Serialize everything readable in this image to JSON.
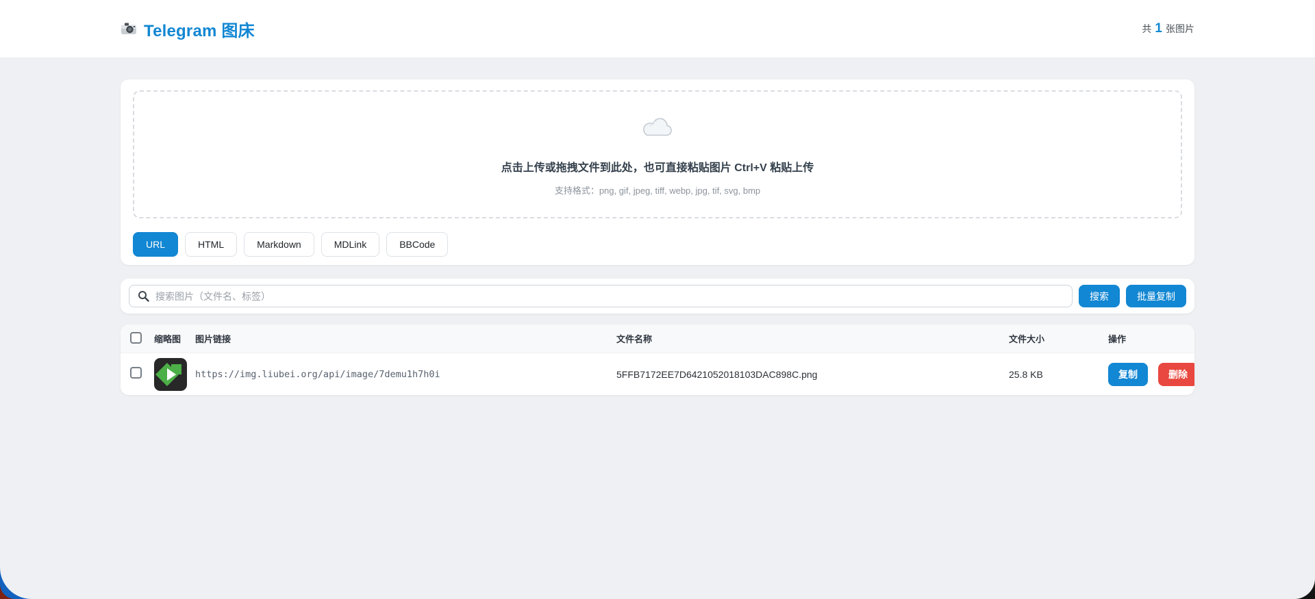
{
  "header": {
    "logo_icon": "camera",
    "title": "Telegram 图床",
    "count_prefix": "共",
    "count_value": "1",
    "count_suffix": "张图片"
  },
  "upload": {
    "cloud_icon": "cloud",
    "main_text": "点击上传或拖拽文件到此处，也可直接粘贴图片 Ctrl+V 粘贴上传",
    "formats_text": "支持格式：png, gif, jpeg, tiff, webp, jpg, tif, svg, bmp"
  },
  "tabs": [
    {
      "label": "URL",
      "active": true
    },
    {
      "label": "HTML",
      "active": false
    },
    {
      "label": "Markdown",
      "active": false
    },
    {
      "label": "MDLink",
      "active": false
    },
    {
      "label": "BBCode",
      "active": false
    }
  ],
  "search": {
    "icon": "magnifier",
    "placeholder": "搜索图片（文件名、标签）",
    "search_button": "搜索",
    "bulk_copy_button": "批量复制"
  },
  "table": {
    "headers": {
      "thumb": "缩略图",
      "link": "图片链接",
      "name": "文件名称",
      "size": "文件大小",
      "actions": "操作"
    },
    "rows": [
      {
        "url": "https://img.liubei.org/api/image/7demu1h7h0i",
        "filename": "5FFB7172EE7D6421052018103DAC898C.png",
        "size": "25.8 KB",
        "copy_label": "复制",
        "delete_label": "删除"
      }
    ]
  },
  "colors": {
    "accent_blue": "#1287d3",
    "danger_red": "#e8483f",
    "page_background": "#eef0f3",
    "thumb_green": "#4caf47",
    "thumb_background": "#282828"
  }
}
